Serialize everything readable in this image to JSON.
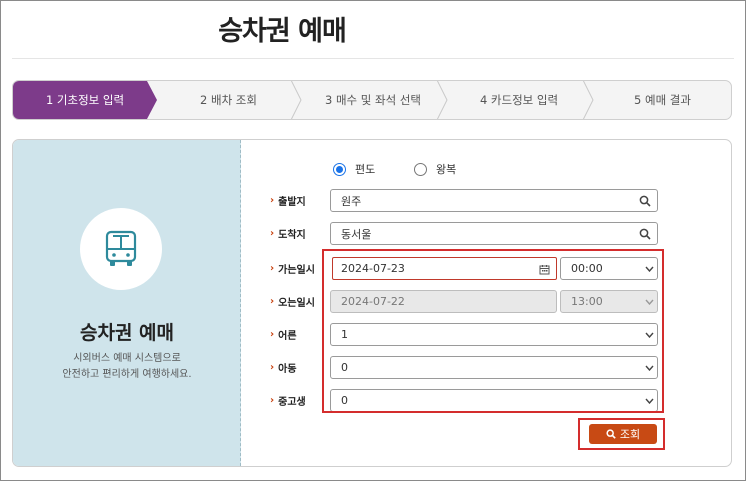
{
  "page": {
    "title": "승차권 예매"
  },
  "steps": [
    {
      "label": "1 기초정보 입력",
      "active": true
    },
    {
      "label": "2 배차 조회",
      "active": false
    },
    {
      "label": "3 매수 및 좌석 선택",
      "active": false
    },
    {
      "label": "4 카드정보 입력",
      "active": false
    },
    {
      "label": "5 예매 결과",
      "active": false
    }
  ],
  "left_panel": {
    "icon": "bus-icon",
    "title": "승차권 예매",
    "desc_line1": "시외버스 예매 시스템으로",
    "desc_line2": "안전하고 편리하게 여행하세요."
  },
  "trip_type": {
    "one_way": "편도",
    "round_trip": "왕복",
    "selected": "편도"
  },
  "form": {
    "departure": {
      "label": "출발지",
      "value": "원주"
    },
    "arrival": {
      "label": "도착지",
      "value": "동서울"
    },
    "go_date": {
      "label": "가는일시",
      "date": "2024-07-23",
      "time": "00:00"
    },
    "return_date": {
      "label": "오는일시",
      "date": "2024-07-22",
      "time": "13:00"
    },
    "adult": {
      "label": "어른",
      "value": "1"
    },
    "child": {
      "label": "아동",
      "value": "0"
    },
    "student": {
      "label": "중고생",
      "value": "0"
    }
  },
  "buttons": {
    "search": "조회"
  },
  "colors": {
    "accent_purple": "#7d3b8a",
    "search_orange": "#c84a14",
    "highlight_red": "#d42d2d",
    "left_panel_bg": "#cfe4eb"
  }
}
